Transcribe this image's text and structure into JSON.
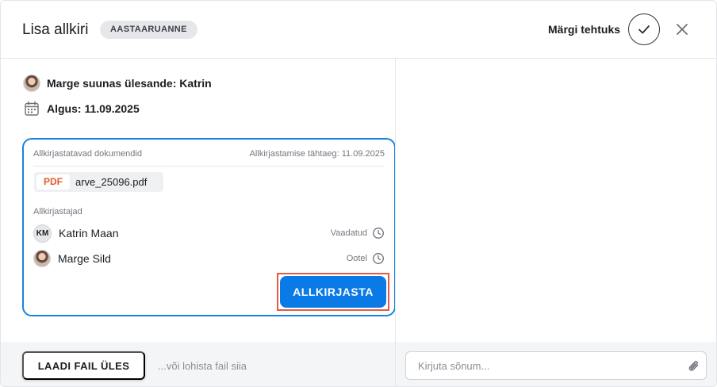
{
  "header": {
    "title": "Lisa allkiri",
    "badge": "AASTAARUANNE",
    "mark_done_label": "Märgi tehtuks"
  },
  "info": {
    "assigned_text": "Marge suunas ülesande: Katrin",
    "start_text": "Algus: 11.09.2025"
  },
  "card": {
    "documents_label": "Allkirjastatavad dokumendid",
    "deadline_label": "Allkirjastamise tähtaeg: 11.09.2025",
    "file": {
      "type_tag": "PDF",
      "name": "arve_25096.pdf"
    },
    "signers_label": "Allkirjastajad",
    "signers": [
      {
        "initials": "KM",
        "name": "Katrin Maan",
        "status": "Vaadatud"
      },
      {
        "initials": "",
        "name": "Marge Sild",
        "status": "Ootel"
      }
    ],
    "sign_button": "ALLKIRJASTA"
  },
  "footer": {
    "upload_button": "LAADI FAIL ÜLES",
    "drop_hint": "...või lohista fail siia",
    "message_placeholder": "Kirjuta sõnum..."
  },
  "colors": {
    "accent": "#0a7ae6",
    "card_border": "#1a82e2",
    "highlight": "#e25b47",
    "pdf_tag": "#e05a2b"
  },
  "icons": [
    "check-icon",
    "close-icon",
    "calendar-icon",
    "clock-icon",
    "paperclip-icon"
  ]
}
